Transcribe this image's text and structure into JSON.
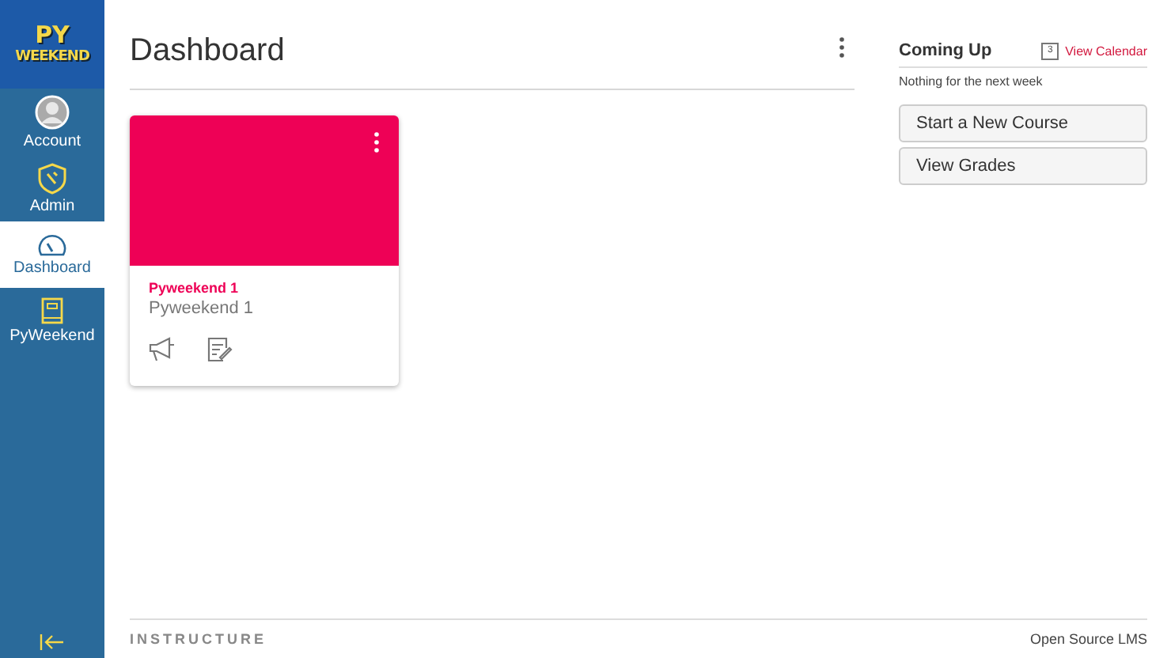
{
  "logo": {
    "line_1": "PY",
    "line_2": "WEEKEND"
  },
  "nav": [
    {
      "label": "Account",
      "kind": "avatar",
      "selected": false
    },
    {
      "label": "Admin",
      "kind": "shield",
      "selected": false
    },
    {
      "label": "Dashboard",
      "kind": "gauge",
      "selected": true
    },
    {
      "label": "PyWeekend",
      "kind": "book",
      "selected": false
    }
  ],
  "title": "Dashboard",
  "cards": [
    {
      "name": "Pyweekend 1",
      "subtitle": "Pyweekend 1",
      "color": "#ee0156"
    }
  ],
  "coming_up": {
    "title": "Coming Up",
    "link": "View Calendar",
    "calendar_day": "3",
    "empty": "Nothing for the next week"
  },
  "buttons": [
    "Start a New Course",
    "View Grades"
  ],
  "footer": {
    "brand": "INSTRUCTURE",
    "note": "Open Source LMS"
  }
}
